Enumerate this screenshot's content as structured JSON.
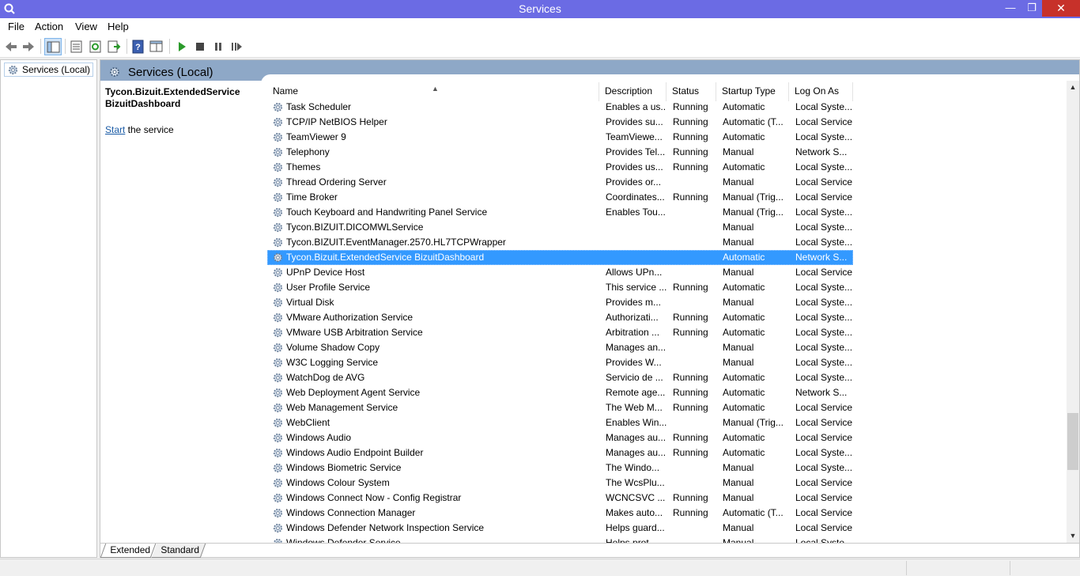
{
  "window": {
    "title": "Services"
  },
  "menu": [
    "File",
    "Action",
    "View",
    "Help"
  ],
  "tree": {
    "root_label": "Services (Local)"
  },
  "panel": {
    "header_title": "Services (Local)",
    "selected_service_name": "Tycon.Bizuit.ExtendedService BizuitDashboard",
    "action_link": "Start",
    "action_suffix": " the service"
  },
  "table": {
    "columns": [
      "Name",
      "Description",
      "Status",
      "Startup Type",
      "Log On As"
    ],
    "selected_index": 10,
    "rows": [
      [
        "Task Scheduler",
        "Enables a us...",
        "Running",
        "Automatic",
        "Local Syste..."
      ],
      [
        "TCP/IP NetBIOS Helper",
        "Provides su...",
        "Running",
        "Automatic (T...",
        "Local Service"
      ],
      [
        "TeamViewer 9",
        "TeamViewe...",
        "Running",
        "Automatic",
        "Local Syste..."
      ],
      [
        "Telephony",
        "Provides Tel...",
        "Running",
        "Manual",
        "Network S..."
      ],
      [
        "Themes",
        "Provides us...",
        "Running",
        "Automatic",
        "Local Syste..."
      ],
      [
        "Thread Ordering Server",
        "Provides or...",
        "",
        "Manual",
        "Local Service"
      ],
      [
        "Time Broker",
        "Coordinates...",
        "Running",
        "Manual (Trig...",
        "Local Service"
      ],
      [
        "Touch Keyboard and Handwriting Panel Service",
        "Enables Tou...",
        "",
        "Manual (Trig...",
        "Local Syste..."
      ],
      [
        "Tycon.BIZUIT.DICOMWLService",
        "",
        "",
        "Manual",
        "Local Syste..."
      ],
      [
        "Tycon.BIZUIT.EventManager.2570.HL7TCPWrapper",
        "",
        "",
        "Manual",
        "Local Syste..."
      ],
      [
        "Tycon.Bizuit.ExtendedService BizuitDashboard",
        "",
        "",
        "Automatic",
        "Network S..."
      ],
      [
        "UPnP Device Host",
        "Allows UPn...",
        "",
        "Manual",
        "Local Service"
      ],
      [
        "User Profile Service",
        "This service ...",
        "Running",
        "Automatic",
        "Local Syste..."
      ],
      [
        "Virtual Disk",
        "Provides m...",
        "",
        "Manual",
        "Local Syste..."
      ],
      [
        "VMware Authorization Service",
        "Authorizati...",
        "Running",
        "Automatic",
        "Local Syste..."
      ],
      [
        "VMware USB Arbitration Service",
        "Arbitration ...",
        "Running",
        "Automatic",
        "Local Syste..."
      ],
      [
        "Volume Shadow Copy",
        "Manages an...",
        "",
        "Manual",
        "Local Syste..."
      ],
      [
        "W3C Logging Service",
        "Provides W...",
        "",
        "Manual",
        "Local Syste..."
      ],
      [
        "WatchDog de AVG",
        "Servicio de ...",
        "Running",
        "Automatic",
        "Local Syste..."
      ],
      [
        "Web Deployment Agent Service",
        "Remote age...",
        "Running",
        "Automatic",
        "Network S..."
      ],
      [
        "Web Management Service",
        "The Web M...",
        "Running",
        "Automatic",
        "Local Service"
      ],
      [
        "WebClient",
        "Enables Win...",
        "",
        "Manual (Trig...",
        "Local Service"
      ],
      [
        "Windows Audio",
        "Manages au...",
        "Running",
        "Automatic",
        "Local Service"
      ],
      [
        "Windows Audio Endpoint Builder",
        "Manages au...",
        "Running",
        "Automatic",
        "Local Syste..."
      ],
      [
        "Windows Biometric Service",
        "The Windo...",
        "",
        "Manual",
        "Local Syste..."
      ],
      [
        "Windows Colour System",
        "The WcsPlu...",
        "",
        "Manual",
        "Local Service"
      ],
      [
        "Windows Connect Now - Config Registrar",
        "WCNCSVC ...",
        "Running",
        "Manual",
        "Local Service"
      ],
      [
        "Windows Connection Manager",
        "Makes auto...",
        "Running",
        "Automatic (T...",
        "Local Service"
      ],
      [
        "Windows Defender Network Inspection Service",
        "Helps guard...",
        "",
        "Manual",
        "Local Service"
      ],
      [
        "Windows Defender Service",
        "Helps prot...",
        "",
        "Manual",
        "Local Syste..."
      ]
    ]
  },
  "tabs": [
    "Extended",
    "Standard"
  ],
  "colors": {
    "titlebar": "#6b6be4",
    "selection": "#3399ff",
    "close": "#c7312a",
    "header": "#8ea8c7"
  }
}
